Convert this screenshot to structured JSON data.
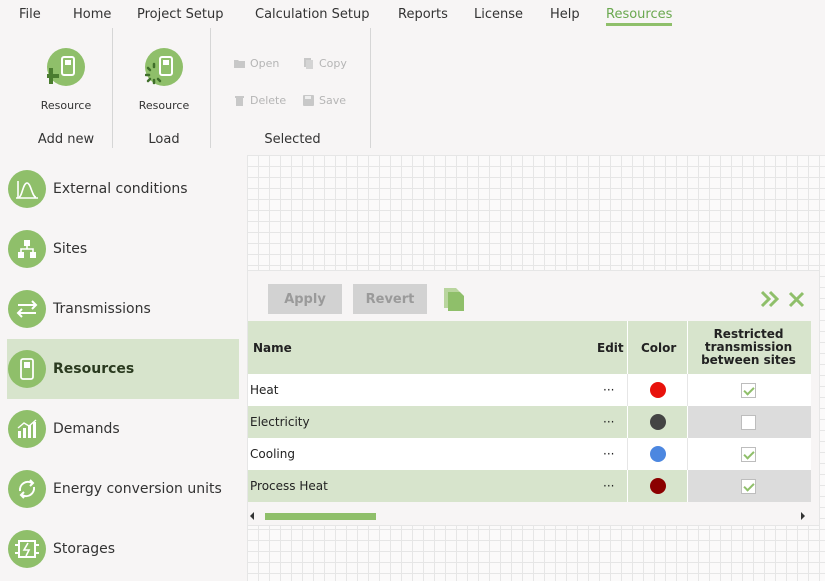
{
  "menu": {
    "items": [
      "File",
      "Home",
      "Project Setup",
      "Calculation Setup",
      "Reports",
      "License",
      "Help",
      "Resources"
    ],
    "active": "Resources"
  },
  "ribbon": {
    "add_new": {
      "button_label": "Resource",
      "group_label": "Add new"
    },
    "load": {
      "button_label": "Resource",
      "group_label": "Load"
    },
    "selected": {
      "open": "Open",
      "copy": "Copy",
      "delete": "Delete",
      "save": "Save",
      "group_label": "Selected"
    }
  },
  "sidebar": {
    "items": [
      {
        "label": "External conditions",
        "icon": "distribution-chart-icon"
      },
      {
        "label": "Sites",
        "icon": "site-network-icon"
      },
      {
        "label": "Transmissions",
        "icon": "two-way-arrows-icon"
      },
      {
        "label": "Resources",
        "icon": "resource-device-icon",
        "active": true
      },
      {
        "label": "Demands",
        "icon": "bar-chart-icon"
      },
      {
        "label": "Energy conversion units",
        "icon": "conversion-cycle-icon"
      },
      {
        "label": "Storages",
        "icon": "storage-battery-icon"
      }
    ]
  },
  "panel": {
    "apply_label": "Apply",
    "revert_label": "Revert",
    "columns": {
      "name": "Name",
      "edit": "Edit",
      "color": "Color",
      "restricted": "Restricted transmission between sites"
    },
    "rows": [
      {
        "name": "Heat",
        "edit": "···",
        "color": "#e8120c",
        "restricted": true
      },
      {
        "name": "Electricity",
        "edit": "···",
        "color": "#444444",
        "restricted": false
      },
      {
        "name": "Cooling",
        "edit": "···",
        "color": "#4c87e0",
        "restricted": true
      },
      {
        "name": "Process Heat",
        "edit": "···",
        "color": "#8b0000",
        "restricted": true
      }
    ]
  },
  "colors": {
    "accent": "#8fbf6a",
    "row_alt": "#d7e4cc"
  }
}
